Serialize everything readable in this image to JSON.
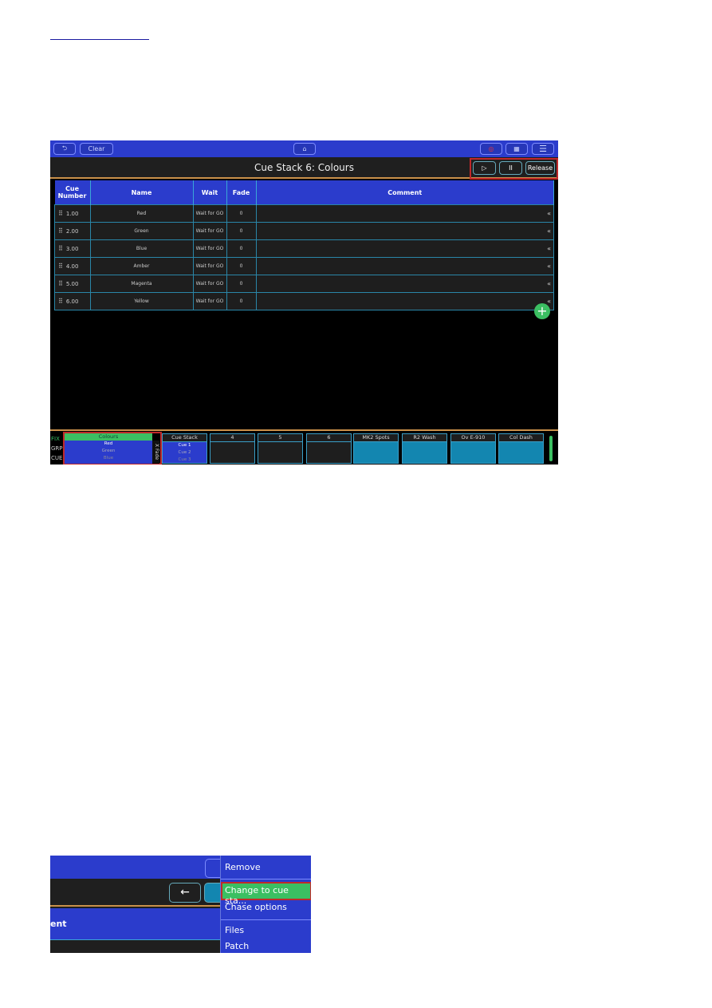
{
  "shot1": {
    "topbar": {
      "back_icon": "undo-arrow-icon",
      "clear": "Clear",
      "home_icon": "home-icon",
      "record_icon": "record-icon",
      "grid_icon": "grid-icon",
      "menu_icon": "hamburger-icon"
    },
    "title": "Cue Stack 6: Colours",
    "controls": {
      "play": "▷",
      "pause": "II",
      "release": "Release"
    },
    "table": {
      "headers": [
        "Cue Number",
        "Name",
        "Wait",
        "Fade",
        "Comment"
      ],
      "rows": [
        {
          "num": "1.00",
          "name": "Red",
          "wait": "Wait for GO",
          "fade": "0"
        },
        {
          "num": "2.00",
          "name": "Green",
          "wait": "Wait for GO",
          "fade": "0"
        },
        {
          "num": "3.00",
          "name": "Blue",
          "wait": "Wait for GO",
          "fade": "0"
        },
        {
          "num": "4.00",
          "name": "Amber",
          "wait": "Wait for GO",
          "fade": "0"
        },
        {
          "num": "5.00",
          "name": "Magenta",
          "wait": "Wait for GO",
          "fade": "0"
        },
        {
          "num": "6.00",
          "name": "Yellow",
          "wait": "Wait for GO",
          "fade": "0"
        }
      ]
    },
    "add": "+",
    "playbacks": {
      "labels": [
        "FIX",
        "GRP",
        "CUE"
      ],
      "colours": {
        "title": "Colours",
        "cues": [
          "Red",
          "Green",
          "Blue"
        ],
        "xfade": "X Fade"
      },
      "cuestack": {
        "title": "Cue Stack",
        "cues": [
          "Cue 1",
          "Cue 2",
          "Cue 3"
        ]
      },
      "tiles": [
        "4",
        "5",
        "6",
        "MK2 Spots",
        "R2 Wash",
        "Ov E-910",
        "Col Dash"
      ]
    }
  },
  "shot2": {
    "header_fragment": "ent",
    "back_arrow": "←",
    "menu": [
      "Remove",
      "Change to cue sta...",
      "Chase options",
      "Files",
      "Patch"
    ]
  },
  "colors": {
    "blue": "#2b3ccc",
    "green": "#3bbf62",
    "highlight": "#c0282a",
    "orange": "#c9904a"
  }
}
